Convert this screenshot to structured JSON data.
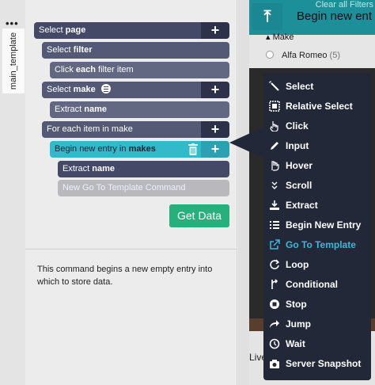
{
  "tab": {
    "menu_dots": "•••",
    "label": "main_template"
  },
  "commands": [
    {
      "prefix": "Select",
      "bold": "page"
    },
    {
      "prefix": "Select",
      "bold": "filter"
    },
    {
      "prefix": "Click",
      "bold": "each",
      "suffix": "filter item"
    },
    {
      "prefix": "Select",
      "bold": "make"
    },
    {
      "prefix": "Extract",
      "bold": "name"
    },
    {
      "prefix": "For each item in make"
    },
    {
      "prefix": "Begin new entry in",
      "bold": "makes"
    },
    {
      "prefix": "Extract",
      "bold": "name"
    },
    {
      "prefix": "New Go To Template Command"
    }
  ],
  "get_data_label": "Get Data",
  "help_text": "This command begins a new empty entry into which to store data.",
  "page_behind": {
    "clear_filters": "Clear all Filters",
    "banner_title": "Begin new ent",
    "facet_header": "Make",
    "facet_item": "Alfa Romeo",
    "facet_count": "(5)",
    "live_text": "Live"
  },
  "menu": {
    "items": [
      {
        "label": "Select",
        "icon": "cursor-wand-icon"
      },
      {
        "label": "Relative Select",
        "icon": "relative-select-icon"
      },
      {
        "label": "Click",
        "icon": "hand-pointer-icon"
      },
      {
        "label": "Input",
        "icon": "pencil-icon"
      },
      {
        "label": "Hover",
        "icon": "hand-hover-icon"
      },
      {
        "label": "Scroll",
        "icon": "scroll-chevrons-icon"
      },
      {
        "label": "Extract",
        "icon": "download-icon"
      },
      {
        "label": "Begin New Entry",
        "icon": "list-icon"
      },
      {
        "label": "Go To Template",
        "icon": "external-link-icon",
        "highlighted": true
      },
      {
        "label": "Loop",
        "icon": "loop-icon"
      },
      {
        "label": "Conditional",
        "icon": "conditional-icon"
      },
      {
        "label": "Stop",
        "icon": "stop-icon"
      },
      {
        "label": "Jump",
        "icon": "jump-arrow-icon"
      },
      {
        "label": "Wait",
        "icon": "clock-icon"
      },
      {
        "label": "Server Snapshot",
        "icon": "camera-icon"
      }
    ]
  },
  "colors": {
    "command_dark": "#454968",
    "command_active": "#33b8cc",
    "get_data": "#27b07c",
    "menu_bg": "#232838",
    "menu_highlight": "#3db8d6",
    "banner": "#1d8f98"
  }
}
